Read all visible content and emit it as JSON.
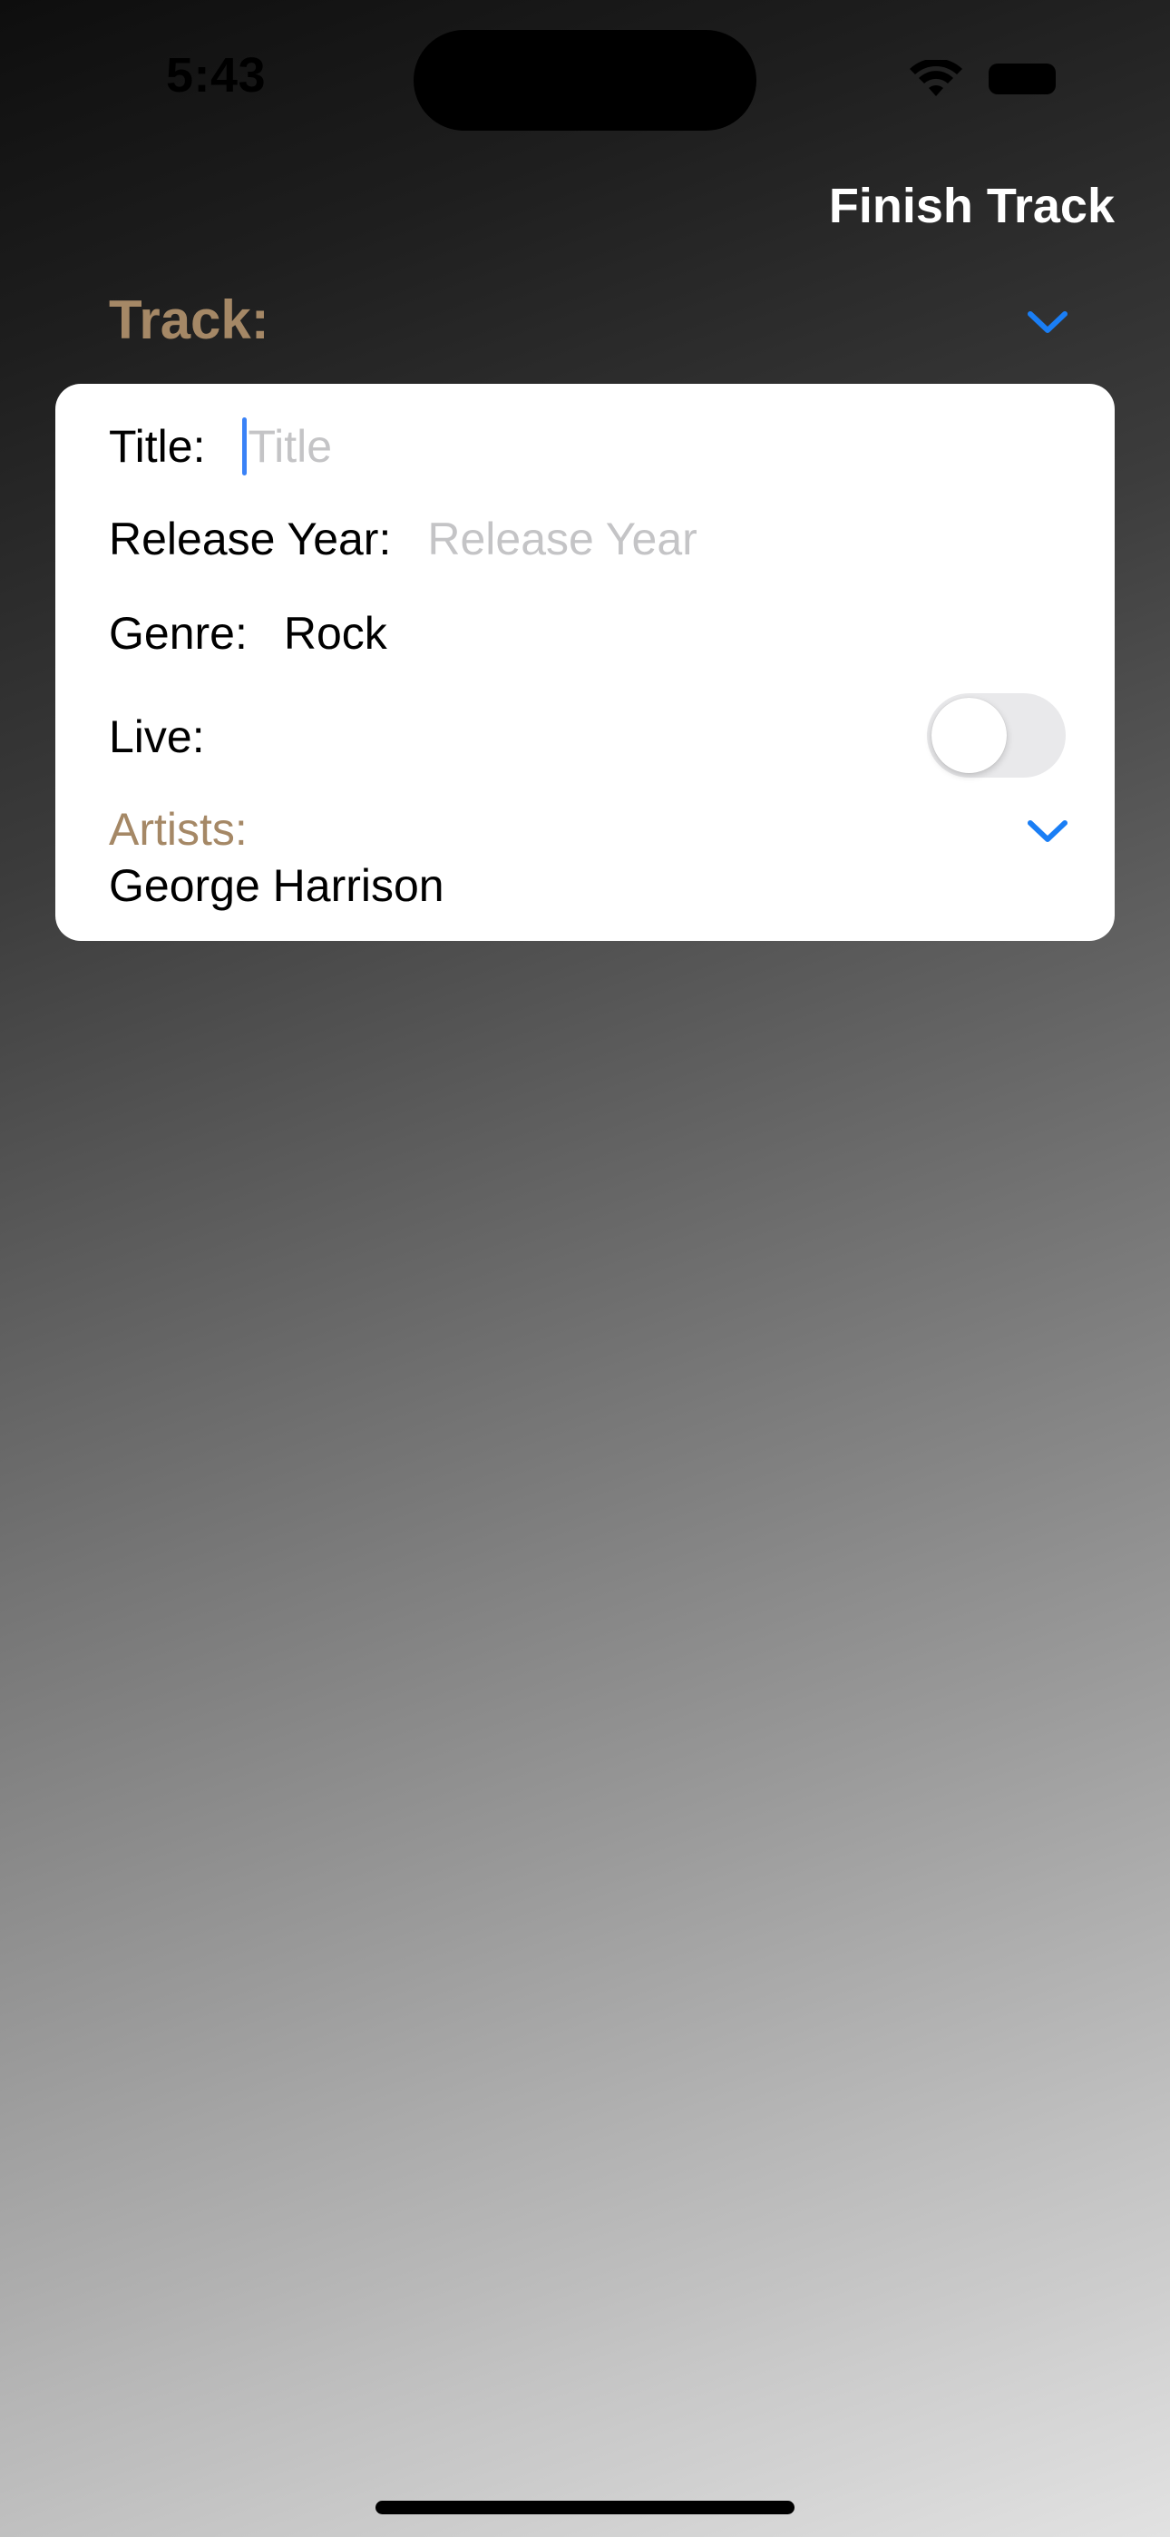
{
  "status_bar": {
    "time": "5:43",
    "icons": [
      "wifi-icon",
      "battery-icon"
    ]
  },
  "header": {
    "finish_label": "Finish Track"
  },
  "track": {
    "section_label": "Track:",
    "accent_color": "#a58866",
    "chevron_color": "#1a7ef5"
  },
  "form": {
    "title_label": "Title:",
    "title_placeholder": "Title",
    "release_year_label": "Release Year:",
    "release_year_placeholder": "Release Year",
    "genre_label": "Genre:",
    "genre_value": "Rock",
    "live_label": "Live:",
    "live_on": false,
    "artists_label": "Artists:",
    "artists_value": "George Harrison"
  }
}
